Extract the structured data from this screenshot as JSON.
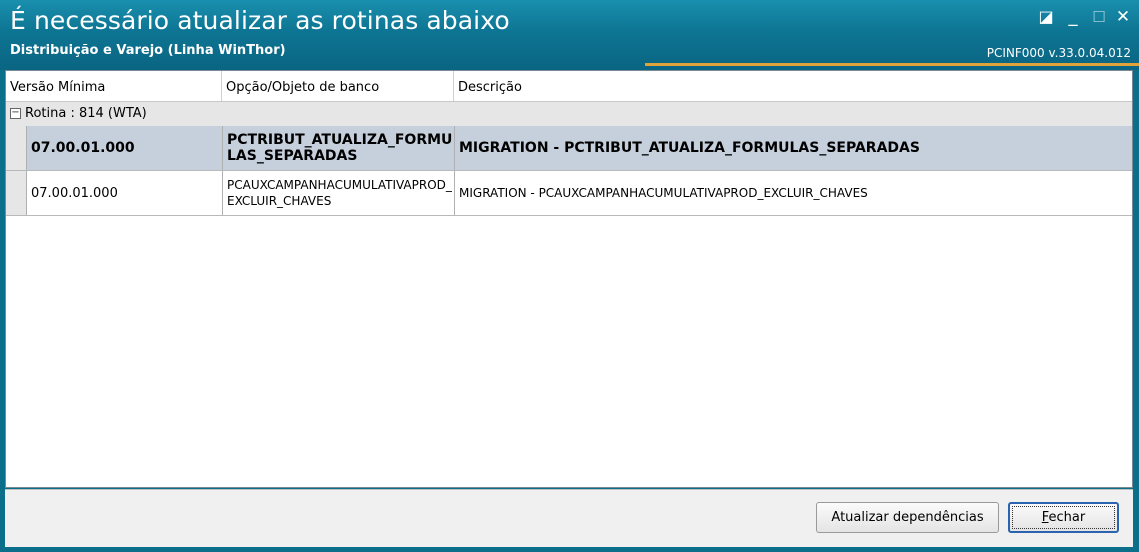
{
  "window": {
    "title": "É necessário atualizar as rotinas abaixo",
    "subtitle": "Distribuição e Varejo (Linha WinThor)",
    "version": "PCINF000  v.33.0.04.012",
    "controls": {
      "restore": "◪",
      "minimize": "_",
      "maximize": "☐",
      "close": "✕"
    }
  },
  "grid": {
    "columns": [
      "Versão Mínima",
      "Opção/Objeto de banco",
      "Descrição"
    ],
    "group": {
      "expander": "−",
      "label": "Rotina : 814 (WTA)"
    },
    "rows": [
      {
        "versao": "07.00.01.000",
        "objeto": "PCTRIBUT_ATUALIZA_FORMULAS_SEPARADAS",
        "descricao": "MIGRATION - PCTRIBUT_ATUALIZA_FORMULAS_SEPARADAS",
        "selected": true
      },
      {
        "versao": "07.00.01.000",
        "objeto": "PCAUXCAMPANHACUMULATIVAPROD_EXCLUIR_CHAVES",
        "descricao": "MIGRATION - PCAUXCAMPANHACUMULATIVAPROD_EXCLUIR_CHAVES",
        "selected": false
      }
    ]
  },
  "buttons": {
    "update": "Atualizar dependências",
    "close_first": "F",
    "close_rest": "echar"
  },
  "colors": {
    "titlebar": "#0d7593",
    "accent": "#e0a23a",
    "selected_row": "#c6d0dc"
  }
}
